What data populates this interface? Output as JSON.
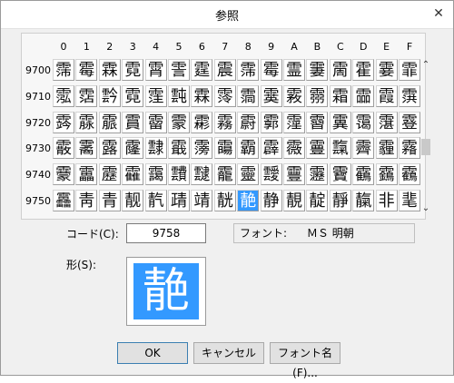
{
  "title": "参照",
  "close_glyph": "✕",
  "columns": [
    "0",
    "1",
    "2",
    "3",
    "4",
    "5",
    "6",
    "7",
    "8",
    "9",
    "A",
    "B",
    "C",
    "D",
    "E",
    "F"
  ],
  "rows": [
    {
      "code": "9700",
      "chars": [
        "霈",
        "霉",
        "霖",
        "霓",
        "霄",
        "霅",
        "霆",
        "震",
        "霈",
        "霉",
        "霊",
        "霋",
        "霌",
        "霍",
        "霎",
        "霏"
      ]
    },
    {
      "code": "9710",
      "chars": [
        "霐",
        "霑",
        "霒",
        "霓",
        "霔",
        "霕",
        "霖",
        "霗",
        "霘",
        "霙",
        "霚",
        "霛",
        "霜",
        "霝",
        "霞",
        "霟"
      ]
    },
    {
      "code": "9720",
      "chars": [
        "霠",
        "霡",
        "霢",
        "霣",
        "霤",
        "霥",
        "霦",
        "霧",
        "霨",
        "霩",
        "霪",
        "霫",
        "霬",
        "霭",
        "霮",
        "霯"
      ]
    },
    {
      "code": "9730",
      "chars": [
        "霰",
        "霱",
        "露",
        "霳",
        "霴",
        "霵",
        "霶",
        "霷",
        "霸",
        "霹",
        "霺",
        "霻",
        "霼",
        "霽",
        "霾",
        "霿"
      ]
    },
    {
      "code": "9740",
      "chars": [
        "靀",
        "靁",
        "靂",
        "靃",
        "靄",
        "靅",
        "靆",
        "靇",
        "靈",
        "靉",
        "靊",
        "靋",
        "靌",
        "靍",
        "靎",
        "靏"
      ]
    },
    {
      "code": "9750",
      "chars": [
        "靐",
        "靑",
        "青",
        "靓",
        "靔",
        "靕",
        "靖",
        "靗",
        "靘",
        "静",
        "靚",
        "靛",
        "靜",
        "靝",
        "非",
        "靟"
      ]
    }
  ],
  "selected": {
    "row": 5,
    "col": 8
  },
  "scroll": {
    "up": "⌃",
    "down": "⌄"
  },
  "code": {
    "label": "コード(C):",
    "value": "9758"
  },
  "font": {
    "label": "フォント:",
    "value": "ＭＳ 明朝"
  },
  "shape": {
    "label": "形(S):",
    "char": "靘"
  },
  "buttons": {
    "ok": "OK",
    "cancel": "キャンセル",
    "font_name": "フォント名(F)..."
  },
  "colors": {
    "selection": "#3399ff"
  }
}
